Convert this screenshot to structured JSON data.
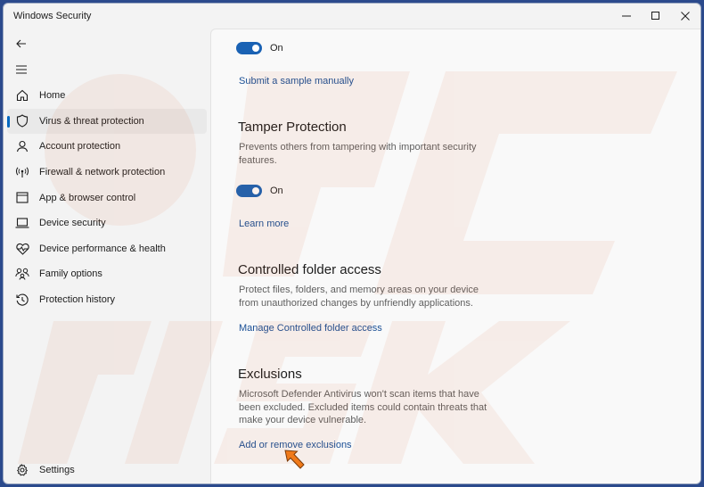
{
  "window": {
    "title": "Windows Security"
  },
  "titlebar_buttons": {
    "minimize_icon": "minimize-icon",
    "maximize_icon": "maximize-icon",
    "close_icon": "close-icon"
  },
  "sidebar": {
    "items": [
      {
        "label": "Home",
        "icon": "home-icon",
        "active": false
      },
      {
        "label": "Virus & threat protection",
        "icon": "shield-icon",
        "active": true
      },
      {
        "label": "Account protection",
        "icon": "person-icon",
        "active": false
      },
      {
        "label": "Firewall & network protection",
        "icon": "antenna-icon",
        "active": false
      },
      {
        "label": "App & browser control",
        "icon": "app-window-icon",
        "active": false
      },
      {
        "label": "Device security",
        "icon": "laptop-icon",
        "active": false
      },
      {
        "label": "Device performance & health",
        "icon": "heart-pulse-icon",
        "active": false
      },
      {
        "label": "Family options",
        "icon": "family-icon",
        "active": false
      },
      {
        "label": "Protection history",
        "icon": "history-icon",
        "active": false
      }
    ],
    "settings_label": "Settings"
  },
  "main": {
    "top_toggle": {
      "state_label": "On",
      "on": true
    },
    "submit_sample_link": "Submit a sample manually",
    "tamper": {
      "title": "Tamper Protection",
      "description": "Prevents others from tampering with important security features.",
      "toggle_label": "On",
      "link": "Learn more"
    },
    "controlled_folder": {
      "title": "Controlled folder access",
      "description": "Protect files, folders, and memory areas on your device from unauthorized changes by unfriendly applications.",
      "link": "Manage Controlled folder access"
    },
    "exclusions": {
      "title": "Exclusions",
      "description": "Microsoft Defender Antivirus won't scan items that have been excluded. Excluded items could contain threats that make your device vulnerable.",
      "link": "Add or remove exclusions"
    }
  },
  "colors": {
    "accent": "#1a62b4",
    "link": "#1a4f95",
    "desktop": "#2b4a8c",
    "pointer": "#f07a1a"
  }
}
